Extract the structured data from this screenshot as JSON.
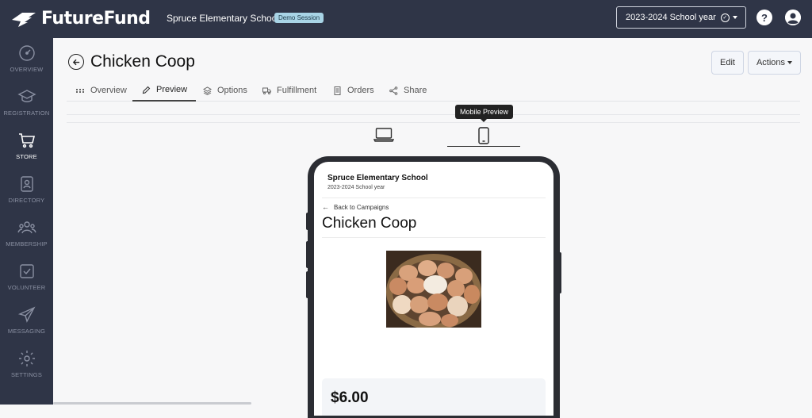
{
  "header": {
    "brand": "FutureFund",
    "school_name": "Spruce Elementary School",
    "demo_badge": "Demo Session",
    "school_year": "2023-2024 School year"
  },
  "sidebar": {
    "items": [
      {
        "label": "OVERVIEW",
        "icon": "dashboard-icon"
      },
      {
        "label": "REGISTRATION",
        "icon": "graduation-cap-icon"
      },
      {
        "label": "STORE",
        "icon": "cart-icon",
        "active": true
      },
      {
        "label": "DIRECTORY",
        "icon": "contacts-icon"
      },
      {
        "label": "MEMBERSHIP",
        "icon": "people-icon"
      },
      {
        "label": "VOLUNTEER",
        "icon": "checkbox-icon"
      },
      {
        "label": "MESSAGING",
        "icon": "paper-plane-icon"
      },
      {
        "label": "SETTINGS",
        "icon": "gear-icon"
      }
    ]
  },
  "page": {
    "title": "Chicken Coop",
    "edit_label": "Edit",
    "actions_label": "Actions"
  },
  "tabs": [
    {
      "label": "Overview",
      "icon": "grid-icon"
    },
    {
      "label": "Preview",
      "icon": "pencil-icon",
      "active": true
    },
    {
      "label": "Options",
      "icon": "layers-icon"
    },
    {
      "label": "Fulfillment",
      "icon": "truck-icon"
    },
    {
      "label": "Orders",
      "icon": "document-icon"
    },
    {
      "label": "Share",
      "icon": "share-icon"
    }
  ],
  "preview": {
    "tooltip": "Mobile Preview",
    "selected_device": "mobile"
  },
  "mobile": {
    "school_name": "Spruce Elementary School",
    "school_year": "2023-2024 School year",
    "back_label": "Back to Campaigns",
    "title": "Chicken Coop",
    "price": "$6.00"
  },
  "colors": {
    "nav_bg": "#2f3547",
    "badge_bg": "#a8d4e6",
    "page_bg": "#f7f7f8"
  }
}
